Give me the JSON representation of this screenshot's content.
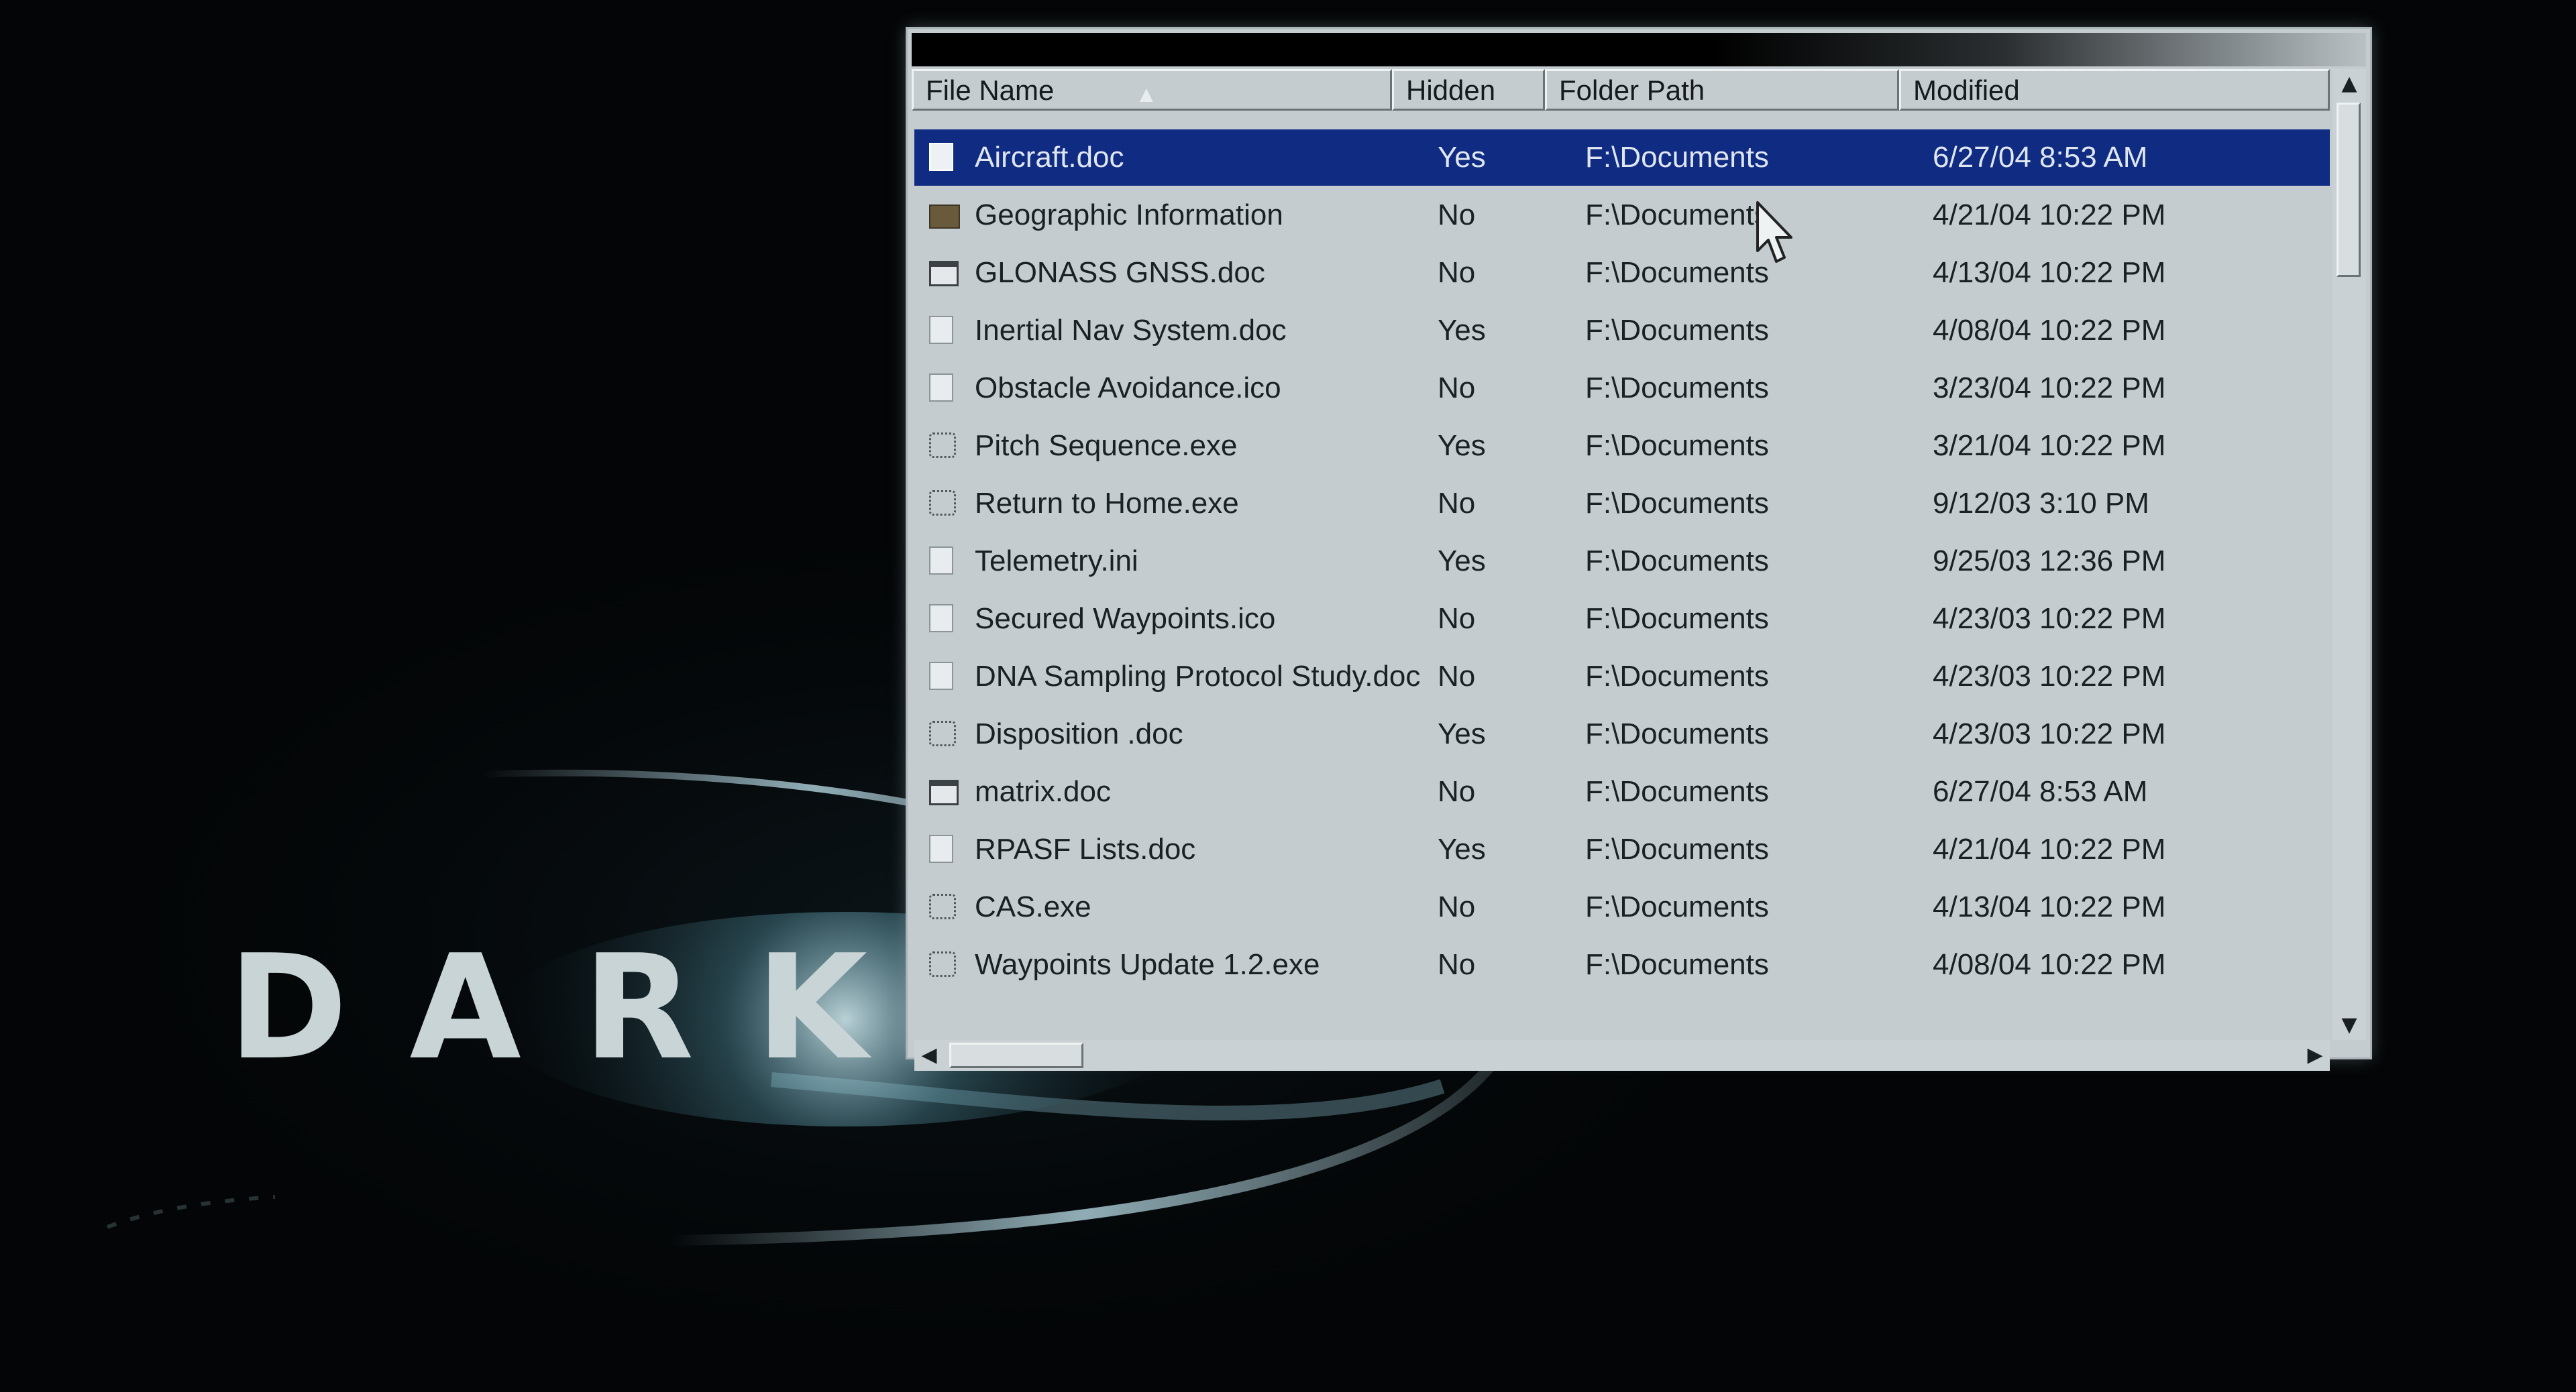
{
  "background": {
    "logo_text": "DARK L",
    "colors": {
      "backdrop": "#040708",
      "logo": "#c9d4d6",
      "swoosh": "#bfe3ee"
    }
  },
  "window": {
    "title": "",
    "controls": {
      "minimize": "_",
      "maximize": "□",
      "close": "✕"
    },
    "columns": [
      {
        "label": "File Name",
        "sorted": true
      },
      {
        "label": "Hidden"
      },
      {
        "label": "Folder Path"
      },
      {
        "label": "Modified"
      }
    ],
    "selection_color": "#0f2b82",
    "rows": [
      {
        "icon": "document-icon",
        "name": "Aircraft.doc",
        "hidden": "Yes",
        "path": "F:\\Documents",
        "modified": "6/27/04 8:53 AM",
        "selected": true
      },
      {
        "icon": "folder-icon",
        "name": "Geographic Information",
        "hidden": "No",
        "path": "F:\\Documents",
        "modified": "4/21/04 10:22 PM"
      },
      {
        "icon": "window-icon",
        "name": "GLONASS GNSS.doc",
        "hidden": "No",
        "path": "F:\\Documents",
        "modified": "4/13/04 10:22 PM"
      },
      {
        "icon": "document-icon",
        "name": "Inertial Nav System.doc",
        "hidden": "Yes",
        "path": "F:\\Documents",
        "modified": "4/08/04 10:22 PM"
      },
      {
        "icon": "document-icon",
        "name": "Obstacle Avoidance.ico",
        "hidden": "No",
        "path": "F:\\Documents",
        "modified": "3/23/04 10:22 PM"
      },
      {
        "icon": "executable-icon",
        "name": "Pitch Sequence.exe",
        "hidden": "Yes",
        "path": "F:\\Documents",
        "modified": "3/21/04 10:22 PM"
      },
      {
        "icon": "executable-icon",
        "name": "Return to Home.exe",
        "hidden": "No",
        "path": "F:\\Documents",
        "modified": "9/12/03 3:10 PM"
      },
      {
        "icon": "document-icon",
        "name": "Telemetry.ini",
        "hidden": "Yes",
        "path": "F:\\Documents",
        "modified": "9/25/03 12:36 PM"
      },
      {
        "icon": "document-icon",
        "name": "Secured Waypoints.ico",
        "hidden": "No",
        "path": "F:\\Documents",
        "modified": "4/23/03 10:22 PM"
      },
      {
        "icon": "document-icon",
        "name": "DNA Sampling Protocol Study.doc",
        "hidden": "No",
        "path": "F:\\Documents",
        "modified": "4/23/03 10:22 PM"
      },
      {
        "icon": "executable-icon",
        "name": "Disposition .doc",
        "hidden": "Yes",
        "path": "F:\\Documents",
        "modified": "4/23/03 10:22 PM"
      },
      {
        "icon": "window-icon",
        "name": "matrix.doc",
        "hidden": "No",
        "path": "F:\\Documents",
        "modified": "6/27/04 8:53 AM"
      },
      {
        "icon": "document-icon",
        "name": "RPASF Lists.doc",
        "hidden": "Yes",
        "path": "F:\\Documents",
        "modified": "4/21/04 10:22 PM"
      },
      {
        "icon": "executable-icon",
        "name": "CAS.exe",
        "hidden": "No",
        "path": "F:\\Documents",
        "modified": "4/13/04 10:22 PM"
      },
      {
        "icon": "executable-icon",
        "name": "Waypoints Update 1.2.exe",
        "hidden": "No",
        "path": "F:\\Documents",
        "modified": "4/08/04 10:22 PM"
      }
    ],
    "scroll": {
      "up": "▲",
      "down": "▼",
      "left": "◀",
      "right": "▶"
    }
  }
}
